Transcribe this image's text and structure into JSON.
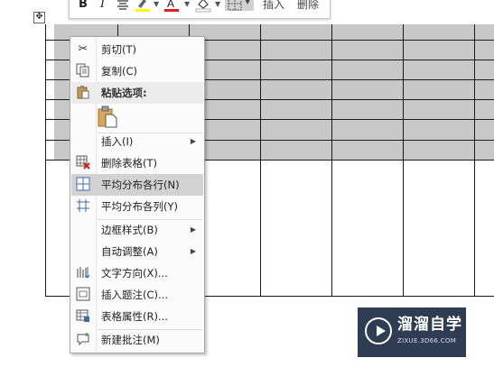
{
  "mini_toolbar": {
    "bold": "B",
    "italic": "I",
    "insert_label": "插入",
    "delete_label": "删除"
  },
  "context_menu": {
    "items": [
      {
        "label": "剪切(T)",
        "icon": "scissors-icon"
      },
      {
        "label": "复制(C)",
        "icon": "copy-icon"
      },
      {
        "label": "粘贴选项:",
        "icon": "paste-icon"
      },
      {
        "label": "插入(I)",
        "submenu": true
      },
      {
        "label": "删除表格(T)",
        "icon": "delete-table-icon"
      },
      {
        "label": "平均分布各行(N)",
        "icon": "distribute-rows-icon",
        "highlighted": true
      },
      {
        "label": "平均分布各列(Y)",
        "icon": "distribute-columns-icon"
      },
      {
        "label": "边框样式(B)",
        "submenu": true
      },
      {
        "label": "自动调整(A)",
        "submenu": true
      },
      {
        "label": "文字方向(X)...",
        "icon": "text-direction-icon"
      },
      {
        "label": "插入题注(C)...",
        "icon": "insert-caption-icon"
      },
      {
        "label": "表格属性(R)...",
        "icon": "table-properties-icon"
      },
      {
        "label": "新建批注(M)",
        "icon": "new-comment-icon"
      }
    ]
  },
  "watermark": {
    "title": "溜溜自学",
    "subtitle": "ZIXUE.3D66.COM"
  },
  "colors": {
    "selection": "#c8c8c8",
    "menu_highlight": "#d2d2d2",
    "watermark_bg": "#2f3d52"
  }
}
